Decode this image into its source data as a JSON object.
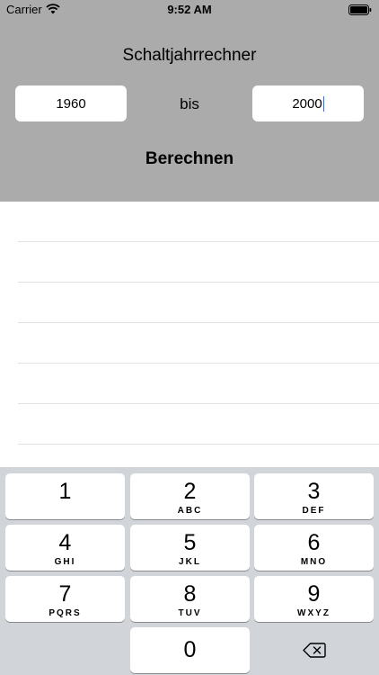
{
  "status_bar": {
    "carrier": "Carrier",
    "time": "9:52 AM"
  },
  "header": {
    "title": "Schaltjahrrechner",
    "from_year": "1960",
    "separator": "bis",
    "to_year": "2000",
    "button_label": "Berechnen"
  },
  "results": {
    "rows": []
  },
  "keyboard": {
    "keys": [
      {
        "digit": "1",
        "letters": ""
      },
      {
        "digit": "2",
        "letters": "ABC"
      },
      {
        "digit": "3",
        "letters": "DEF"
      },
      {
        "digit": "4",
        "letters": "GHI"
      },
      {
        "digit": "5",
        "letters": "JKL"
      },
      {
        "digit": "6",
        "letters": "MNO"
      },
      {
        "digit": "7",
        "letters": "PQRS"
      },
      {
        "digit": "8",
        "letters": "TUV"
      },
      {
        "digit": "9",
        "letters": "WXYZ"
      },
      {
        "digit": "0",
        "letters": ""
      }
    ],
    "delete_icon": "backspace-icon"
  }
}
